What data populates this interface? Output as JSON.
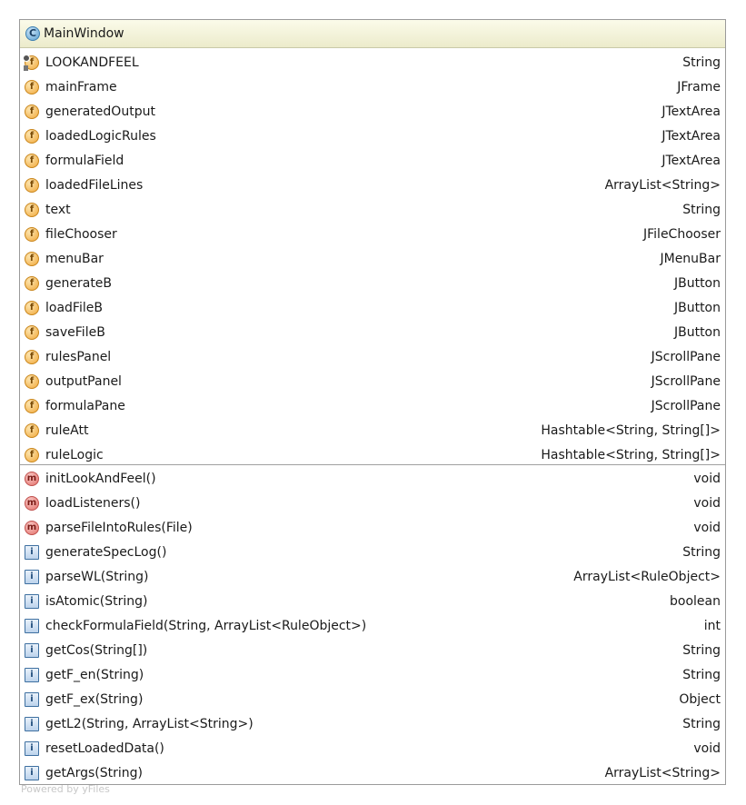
{
  "class": {
    "icon": "class-icon",
    "icon_letter": "C",
    "name": "MainWindow"
  },
  "fields": [
    {
      "name": "LOOKANDFEEL",
      "type": "String",
      "kind": "static-field",
      "letter": "f"
    },
    {
      "name": "mainFrame",
      "type": "JFrame",
      "kind": "field",
      "letter": "f"
    },
    {
      "name": "generatedOutput",
      "type": "JTextArea",
      "kind": "field",
      "letter": "f"
    },
    {
      "name": "loadedLogicRules",
      "type": "JTextArea",
      "kind": "field",
      "letter": "f"
    },
    {
      "name": "formulaField",
      "type": "JTextArea",
      "kind": "field",
      "letter": "f"
    },
    {
      "name": "loadedFileLines",
      "type": "ArrayList<String>",
      "kind": "field",
      "letter": "f"
    },
    {
      "name": "text",
      "type": "String",
      "kind": "field",
      "letter": "f"
    },
    {
      "name": "fileChooser",
      "type": "JFileChooser",
      "kind": "field",
      "letter": "f"
    },
    {
      "name": "menuBar",
      "type": "JMenuBar",
      "kind": "field",
      "letter": "f"
    },
    {
      "name": "generateB",
      "type": "JButton",
      "kind": "field",
      "letter": "f"
    },
    {
      "name": "loadFileB",
      "type": "JButton",
      "kind": "field",
      "letter": "f"
    },
    {
      "name": "saveFileB",
      "type": "JButton",
      "kind": "field",
      "letter": "f"
    },
    {
      "name": "rulesPanel",
      "type": "JScrollPane",
      "kind": "field",
      "letter": "f"
    },
    {
      "name": "outputPanel",
      "type": "JScrollPane",
      "kind": "field",
      "letter": "f"
    },
    {
      "name": "formulaPane",
      "type": "JScrollPane",
      "kind": "field",
      "letter": "f"
    },
    {
      "name": "ruleAtt",
      "type": "Hashtable<String, String[]>",
      "kind": "field",
      "letter": "f"
    },
    {
      "name": "ruleLogic",
      "type": "Hashtable<String, String[]>",
      "kind": "field",
      "letter": "f"
    }
  ],
  "methods": [
    {
      "name": "initLookAndFeel()",
      "type": "void",
      "kind": "method",
      "letter": "m"
    },
    {
      "name": "loadListeners()",
      "type": "void",
      "kind": "method",
      "letter": "m"
    },
    {
      "name": "parseFileIntoRules(File)",
      "type": "void",
      "kind": "method",
      "letter": "m"
    },
    {
      "name": "generateSpecLog()",
      "type": "String",
      "kind": "abstract-method",
      "letter": "i"
    },
    {
      "name": "parseWL(String)",
      "type": "ArrayList<RuleObject>",
      "kind": "abstract-method",
      "letter": "i"
    },
    {
      "name": "isAtomic(String)",
      "type": "boolean",
      "kind": "abstract-method",
      "letter": "i"
    },
    {
      "name": "checkFormulaField(String, ArrayList<RuleObject>)",
      "type": "int",
      "kind": "abstract-method",
      "letter": "i"
    },
    {
      "name": "getCos(String[])",
      "type": "String",
      "kind": "abstract-method",
      "letter": "i"
    },
    {
      "name": "getF_en(String)",
      "type": "String",
      "kind": "abstract-method",
      "letter": "i"
    },
    {
      "name": "getF_ex(String)",
      "type": "Object",
      "kind": "abstract-method",
      "letter": "i"
    },
    {
      "name": "getL2(String, ArrayList<String>)",
      "type": "String",
      "kind": "abstract-method",
      "letter": "i"
    },
    {
      "name": "resetLoadedData()",
      "type": "void",
      "kind": "abstract-method",
      "letter": "i"
    },
    {
      "name": "getArgs(String)",
      "type": "ArrayList<String>",
      "kind": "abstract-method",
      "letter": "i"
    }
  ],
  "footer": {
    "watermark": "Powered by yFiles"
  }
}
